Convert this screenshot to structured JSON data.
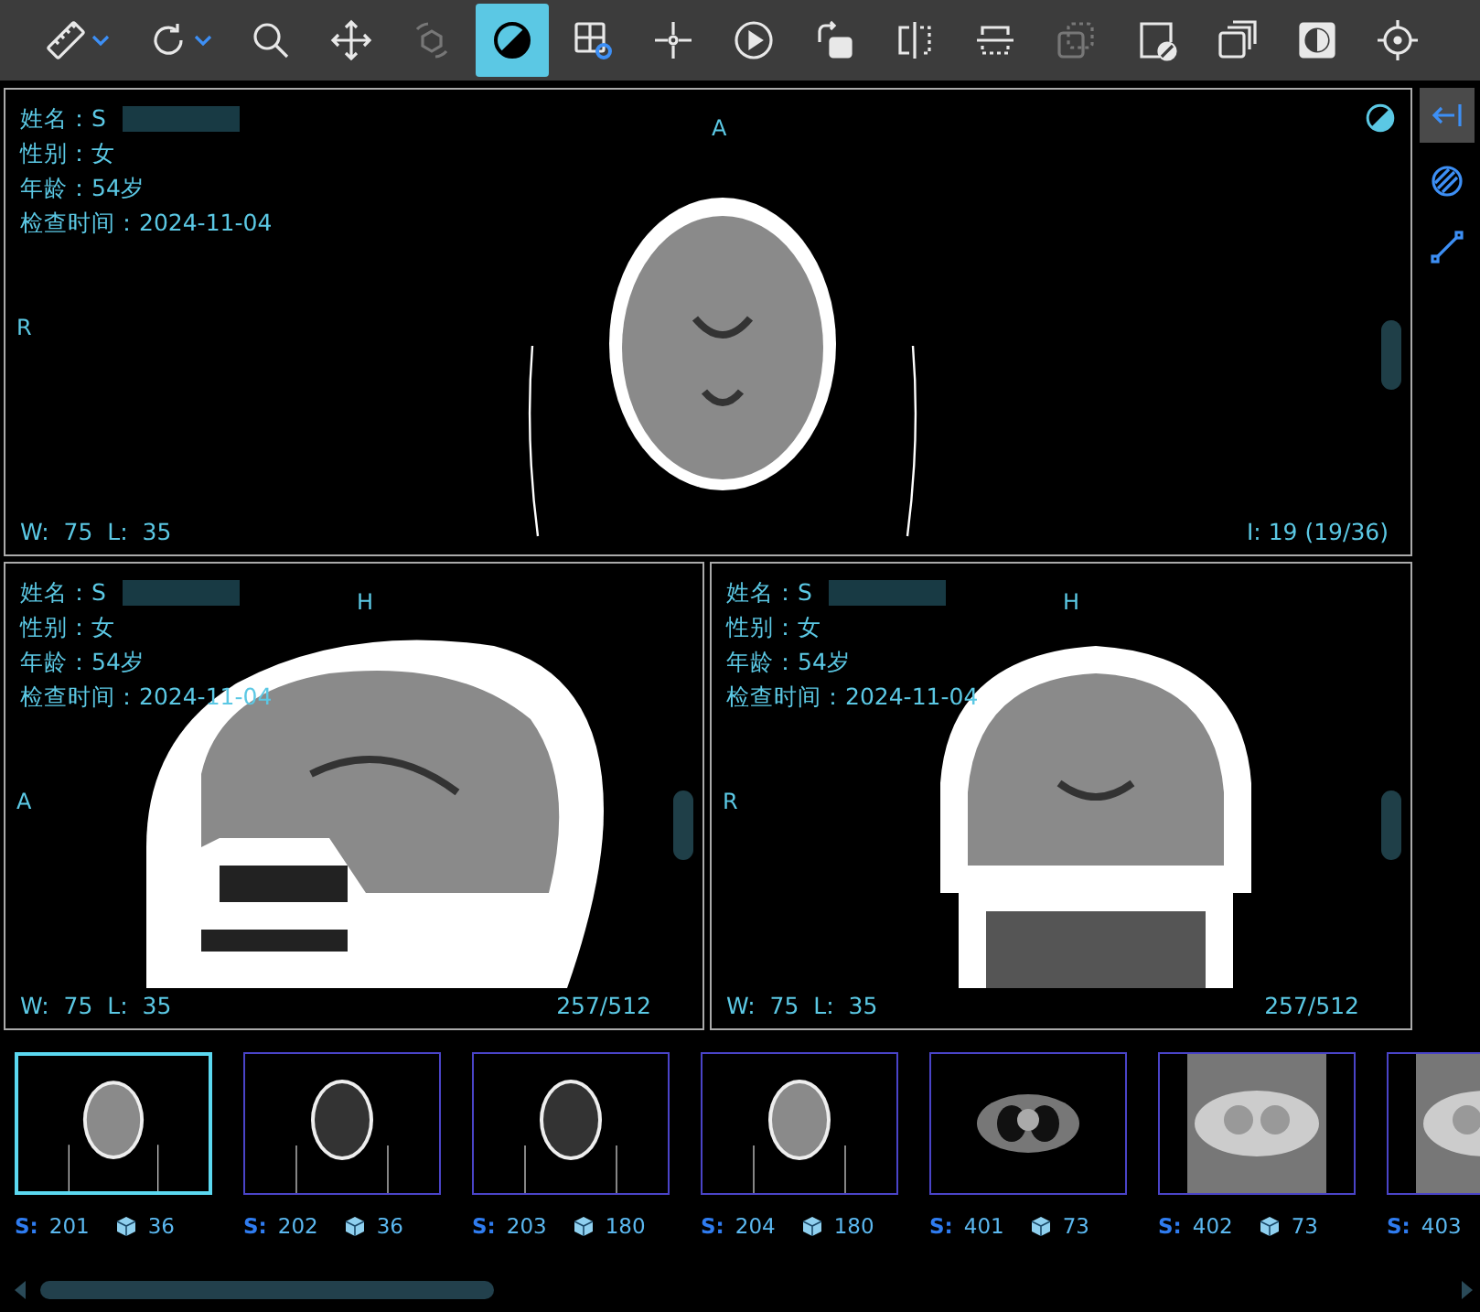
{
  "toolbar": [
    {
      "kind": "ruler",
      "selected": false,
      "disabled": false,
      "dropdown": true
    },
    {
      "kind": "rotate",
      "selected": false,
      "disabled": false,
      "dropdown": true
    },
    {
      "kind": "zoom",
      "selected": false,
      "disabled": false,
      "dropdown": false
    },
    {
      "kind": "pan",
      "selected": false,
      "disabled": false,
      "dropdown": false
    },
    {
      "kind": "rotate3d",
      "selected": false,
      "disabled": true,
      "dropdown": false
    },
    {
      "kind": "contrast",
      "selected": true,
      "disabled": false,
      "dropdown": false
    },
    {
      "kind": "layout",
      "selected": false,
      "disabled": false,
      "dropdown": false
    },
    {
      "kind": "crosshair",
      "selected": false,
      "disabled": false,
      "dropdown": false
    },
    {
      "kind": "play",
      "selected": false,
      "disabled": false,
      "dropdown": false
    },
    {
      "kind": "rotate-image",
      "selected": false,
      "disabled": false,
      "dropdown": false
    },
    {
      "kind": "flip-h",
      "selected": false,
      "disabled": false,
      "dropdown": false
    },
    {
      "kind": "flip-v",
      "selected": false,
      "disabled": false,
      "dropdown": false
    },
    {
      "kind": "overlap",
      "selected": false,
      "disabled": true,
      "dropdown": false
    },
    {
      "kind": "frame-contrast",
      "selected": false,
      "disabled": false,
      "dropdown": false
    },
    {
      "kind": "stack",
      "selected": false,
      "disabled": false,
      "dropdown": false
    },
    {
      "kind": "invert",
      "selected": false,
      "disabled": false,
      "dropdown": false
    },
    {
      "kind": "target",
      "selected": false,
      "disabled": false,
      "dropdown": false
    }
  ],
  "viewports": [
    {
      "kind": "axial",
      "info": [
        "姓名：S",
        "性别：女",
        "年龄：54岁",
        "检查时间：2024-11-04"
      ],
      "top_label": "A",
      "left_label": "R",
      "window": "W:  75  L:  35",
      "position": "I: 19 (19/36)",
      "contrast_badge": true
    },
    {
      "kind": "sagittal",
      "info": [
        "姓名：S",
        "性别：女",
        "年龄：54岁",
        "检查时间：2024-11-04"
      ],
      "top_label": "H",
      "left_label": "A",
      "window": "W:  75  L:  35",
      "position": "257/512",
      "contrast_badge": false
    },
    {
      "kind": "coronal",
      "info": [
        "姓名：S",
        "性别：女",
        "年龄：54岁",
        "检查时间：2024-11-04"
      ],
      "top_label": "H",
      "left_label": "R",
      "window": "W:  75  L:  35",
      "position": "257/512",
      "contrast_badge": false
    }
  ],
  "sidebar": [
    {
      "kind": "collapse",
      "selected": true
    },
    {
      "kind": "hatch",
      "selected": false
    },
    {
      "kind": "line",
      "selected": false
    }
  ],
  "series": [
    {
      "kind": "brain",
      "label": "S:",
      "number": "201",
      "count": "36",
      "selected": true
    },
    {
      "kind": "brain-bone",
      "label": "S:",
      "number": "202",
      "count": "36",
      "selected": false
    },
    {
      "kind": "brain-bone",
      "label": "S:",
      "number": "203",
      "count": "180",
      "selected": false
    },
    {
      "kind": "brain",
      "label": "S:",
      "number": "204",
      "count": "180",
      "selected": false
    },
    {
      "kind": "chest",
      "label": "S:",
      "number": "401",
      "count": "73",
      "selected": false
    },
    {
      "kind": "chest-soft",
      "label": "S:",
      "number": "402",
      "count": "73",
      "selected": false
    },
    {
      "kind": "chest-soft",
      "label": "S:",
      "number": "403",
      "selected": false
    }
  ]
}
